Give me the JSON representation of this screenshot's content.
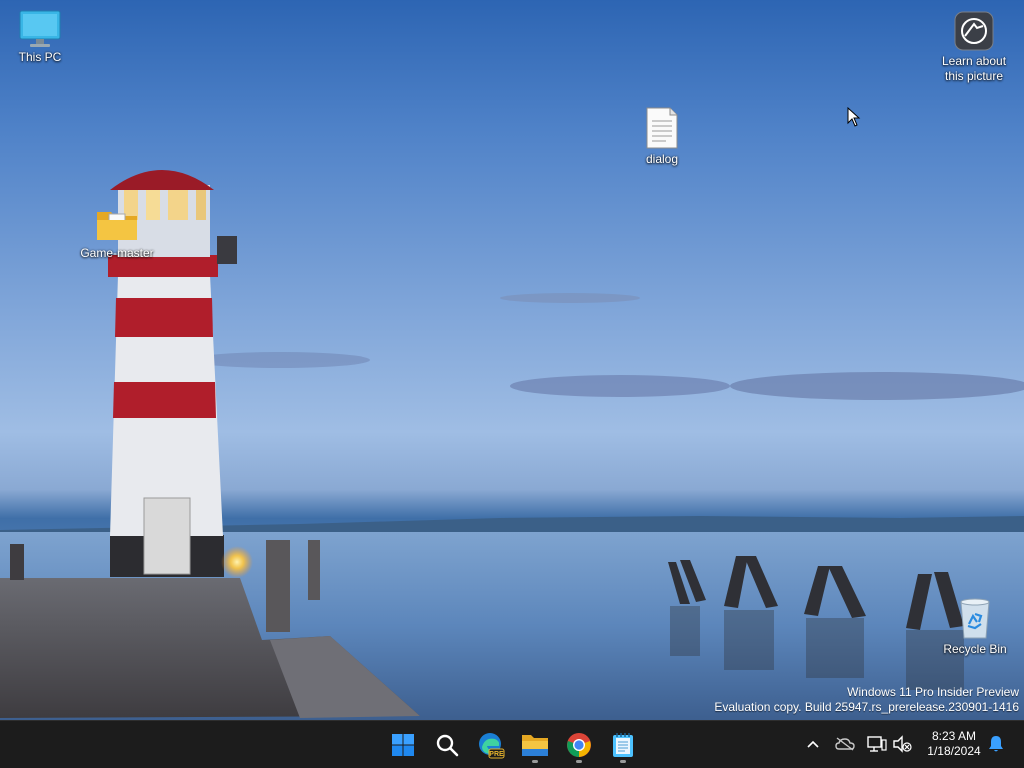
{
  "desktop": {
    "icons": {
      "this_pc": {
        "label": "This PC",
        "icon": "computer-monitor-icon"
      },
      "learn_picture": {
        "label": "Learn about this picture",
        "icon": "camera-spotlight-icon"
      },
      "dialog": {
        "label": "dialog",
        "icon": "text-file-icon"
      },
      "game_master": {
        "label": "Game-master",
        "icon": "folder-icon"
      },
      "recycle_bin": {
        "label": "Recycle Bin",
        "icon": "recycle-bin-icon"
      }
    },
    "watermark": {
      "line1": "Windows 11 Pro Insider Preview",
      "line2": "Evaluation copy. Build 25947.rs_prerelease.230901-1416"
    }
  },
  "taskbar": {
    "apps": [
      "start",
      "search",
      "edge-preview",
      "file-explorer",
      "chrome",
      "notepad"
    ],
    "edge_badge": "PRE",
    "clock": {
      "time": "8:23 AM",
      "date": "1/18/2024"
    }
  },
  "colors": {
    "taskbar_bg": "#1c1c1c",
    "start_blue": "#1e90ff",
    "folder_yellow": "#f4c542",
    "lighthouse_red": "#b01e2b"
  }
}
